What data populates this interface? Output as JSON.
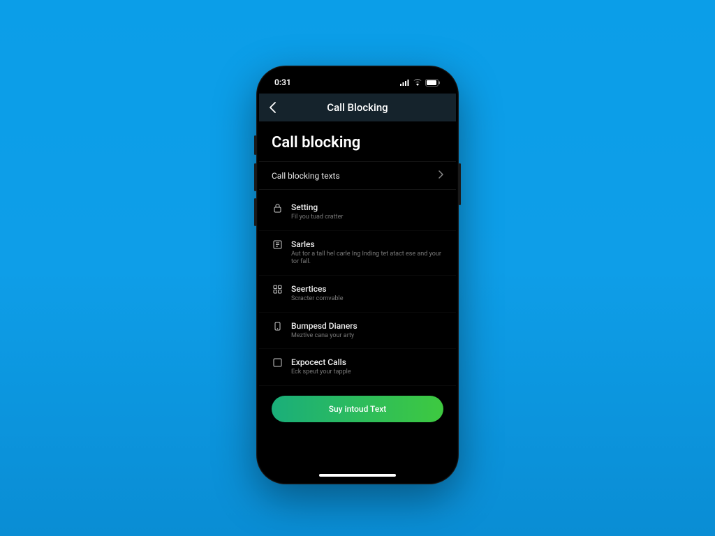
{
  "status": {
    "time": "0:31"
  },
  "nav": {
    "title": "Call Blocking"
  },
  "page": {
    "title": "Call blocking"
  },
  "link_row": {
    "label": "Call blocking texts"
  },
  "items": [
    {
      "icon": "lock-icon",
      "label": "Setting",
      "desc": "Fil you tuad cratter"
    },
    {
      "icon": "list-icon",
      "label": "Sarles",
      "desc": "Aut tor a tall hel carle Ing Inding tet atact ese and your tor fall."
    },
    {
      "icon": "grid-icon",
      "label": "Seertices",
      "desc": "Scracter comvable"
    },
    {
      "icon": "phone-icon",
      "label": "Bumpesd Dianers",
      "desc": "Meztive cana your arty"
    },
    {
      "icon": "checkbox-icon",
      "label": "Expocect Calls",
      "desc": "Eck speut your tapple"
    }
  ],
  "cta": {
    "label": "Suy intoud Text"
  }
}
